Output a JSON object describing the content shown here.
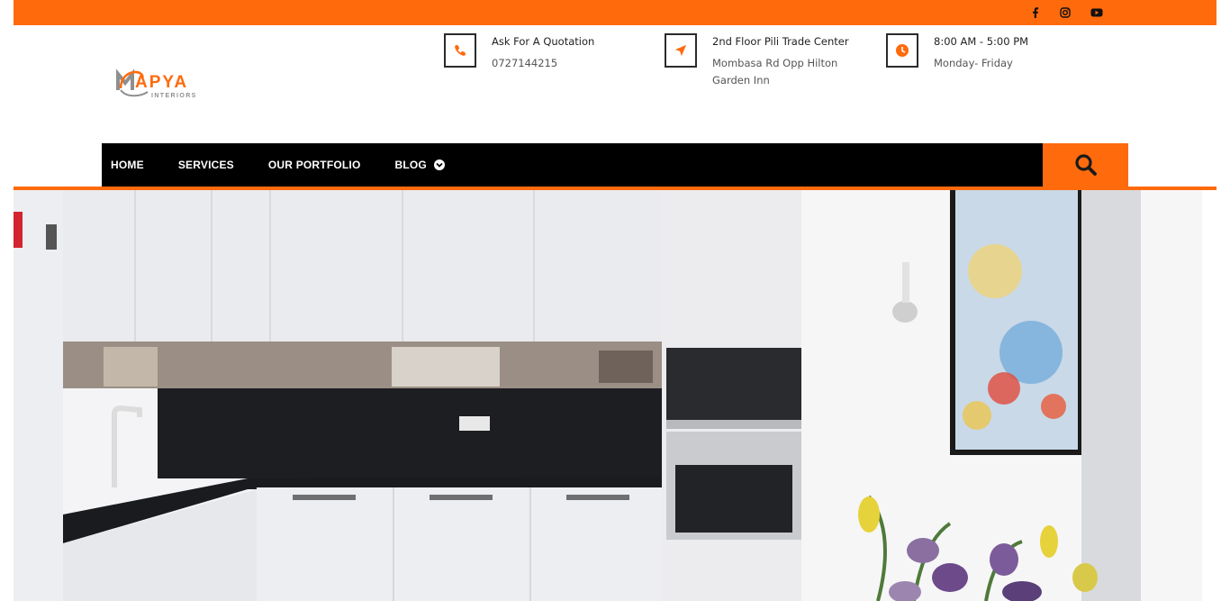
{
  "colors": {
    "accent": "#ff6a0d",
    "nav_bg": "#000000"
  },
  "topbar": {
    "social": [
      {
        "icon": "facebook-icon"
      },
      {
        "icon": "instagram-icon"
      },
      {
        "icon": "youtube-icon"
      }
    ]
  },
  "logo": {
    "brand": "MAPYA",
    "sub": "INTERIORS"
  },
  "contact": [
    {
      "icon": "phone-icon",
      "title": "Ask For A Quotation",
      "detail": "0727144215"
    },
    {
      "icon": "location-arrow-icon",
      "title": "2nd Floor Pili Trade Center",
      "detail": "Mombasa Rd Opp Hilton Garden Inn"
    },
    {
      "icon": "clock-icon",
      "title": "8:00 AM - 5:00 PM",
      "detail": "Monday- Friday"
    }
  ],
  "nav": {
    "items": [
      {
        "label": "HOME"
      },
      {
        "label": "SERVICES"
      },
      {
        "label": "OUR PORTFOLIO"
      },
      {
        "label": "BLOG"
      }
    ]
  }
}
